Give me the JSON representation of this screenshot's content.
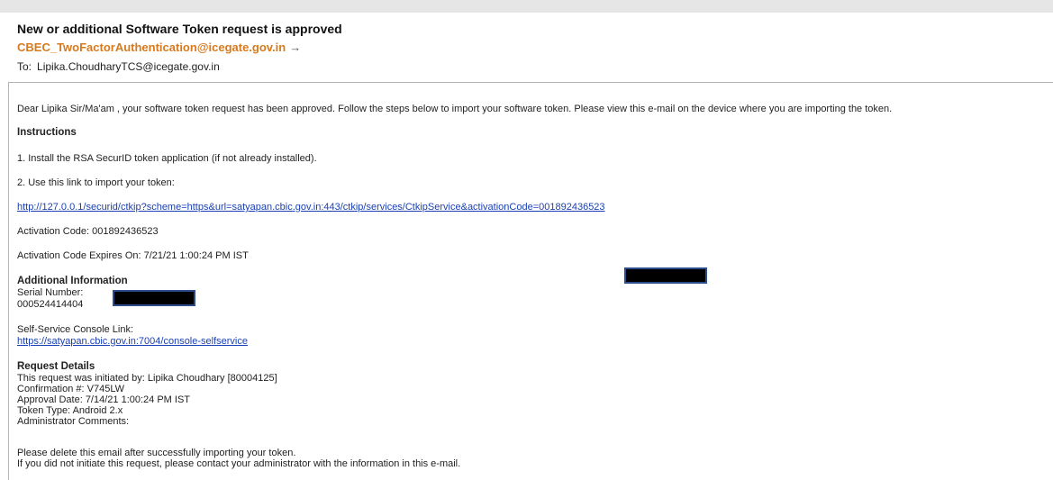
{
  "email": {
    "subject": "New or additional Software Token request is approved",
    "from": "CBEC_TwoFactorAuthentication@icegate.gov.in",
    "from_arrow": "→",
    "to_label": "To:",
    "to": "Lipika.ChoudharyTCS@icegate.gov.in"
  },
  "body": {
    "greeting": "Dear Lipika Sir/Ma'am , your software token request has been approved. Follow the steps below to import your software token. Please view this e-mail on the device where you are importing the token.",
    "instructions_heading": "Instructions",
    "step1": "1. Install the RSA SecurID token application (if not already installed).",
    "step2": "2. Use this link to import your token:",
    "import_link": "http://127.0.0.1/securid/ctkip?scheme=https&url=satyapan.cbic.gov.in:443/ctkip/services/CtkipService&activationCode=001892436523",
    "activation_code": "Activation Code: 001892436523",
    "activation_expires": "Activation Code Expires On: 7/21/21 1:00:24 PM IST",
    "additional_heading": "Additional Information",
    "serial_label": "Serial Number:",
    "serial_value": "000524414404",
    "console_label": "Self-Service Console Link:",
    "console_link": "https://satyapan.cbic.gov.in:7004/console-selfservice",
    "request_heading": "Request Details",
    "request_lines": [
      "This request was initiated by: Lipika Choudhary [80004125]",
      "Confirmation #: V745LW",
      "Approval Date: 7/14/21 1:00:24 PM IST",
      "Token Type: Android 2.x",
      "Administrator Comments:"
    ],
    "footer_lines": [
      "Please delete this email after successfully importing your token.",
      "If you did not initiate this request, please contact your administrator with the information in this e-mail."
    ]
  }
}
